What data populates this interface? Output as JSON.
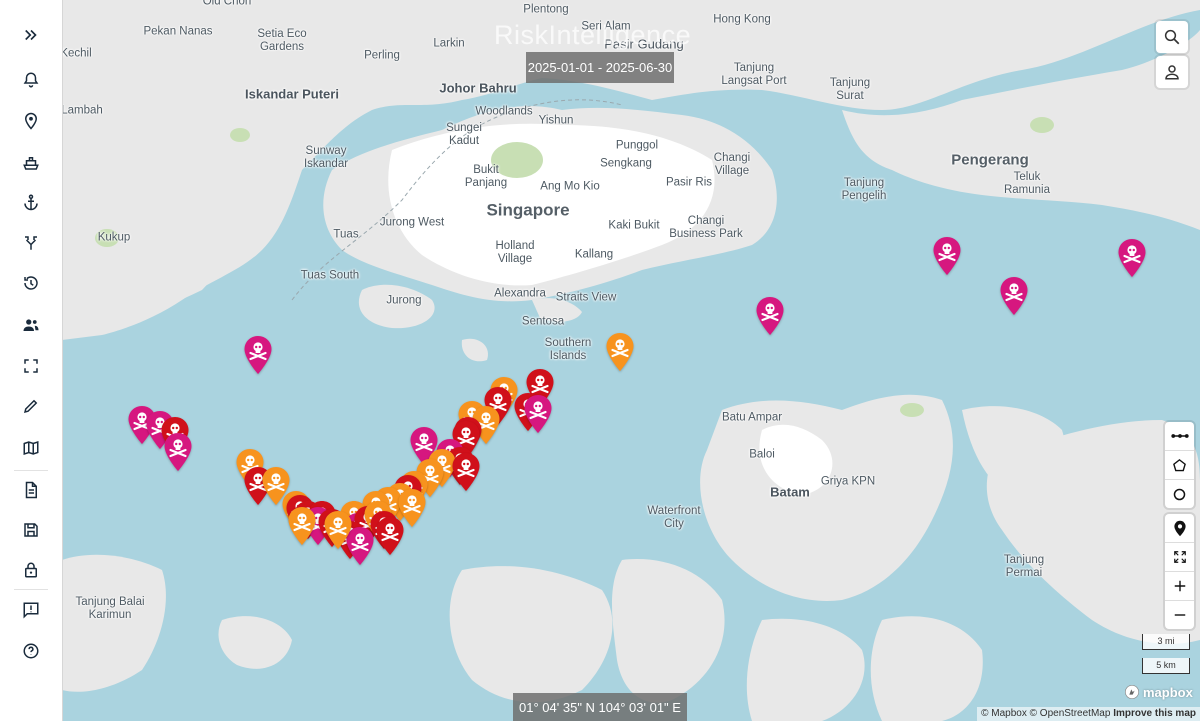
{
  "app": {
    "watermark": "RiskIntelligence"
  },
  "sidebar": {
    "items": [
      {
        "icon": "expand-chevrons-icon"
      },
      {
        "icon": "bell-icon"
      },
      {
        "icon": "location-pin-icon"
      },
      {
        "icon": "ship-icon"
      },
      {
        "icon": "anchor-icon"
      },
      {
        "icon": "route-fork-icon"
      },
      {
        "icon": "history-icon"
      },
      {
        "icon": "people-icon"
      },
      {
        "icon": "frame-select-icon"
      },
      {
        "icon": "pencil-icon"
      },
      {
        "icon": "map-icon"
      },
      {
        "icon": "document-icon"
      },
      {
        "icon": "save-icon"
      },
      {
        "icon": "lock-icon"
      },
      {
        "icon": "feedback-icon"
      },
      {
        "icon": "help-icon"
      }
    ]
  },
  "map": {
    "date_range": "2025-01-01 - 2025-06-30",
    "coordinate_readout": "01° 04' 35\" N 104° 03' 01\" E",
    "scale_miles": "3 mi",
    "scale_km": "5 km",
    "logo": "mapbox",
    "attribution": {
      "mapbox": "© Mapbox",
      "osm": "© OpenStreetMap",
      "improve": "Improve this map"
    },
    "colors": {
      "water": "#aad3df",
      "land": "#e8e8e8",
      "park": "#c8dfb4",
      "urban": "#ffffff",
      "marker_magenta": "#d6177f",
      "marker_orange": "#f7931e",
      "marker_red": "#d0101a"
    },
    "places": {
      "old_chon": "Old Chon",
      "pekan_nanas": "Pekan Nanas",
      "setia_eco_gardens": "Setia Eco\nGardens",
      "perling": "Perling",
      "larkin": "Larkin",
      "plentong": "Plentong",
      "seri_alam": "Seri Alam",
      "pasir_gudang": "Pasir Gudang",
      "hong_kong": "Hong Kong",
      "tanjung_langsat_port": "Tanjung\nLangsat Port",
      "tanjung_surat": "Tanjung\nSurat",
      "kechil": "Kechil",
      "iskandar_puteri": "Iskandar Puteri",
      "johor_bahru": "Johor Bahru",
      "woodlands": "Woodlands",
      "yishun": "Yishun",
      "lambah": "Lambah",
      "sungei_kadut": "Sungei\nKadut",
      "punggol": "Punggol",
      "sengkang": "Sengkang",
      "changi_village": "Changi\nVillage",
      "pengerang": "Pengerang",
      "teluk_ramunia": "Teluk\nRamunia",
      "sunway_iskandar": "Sunway\nIskandar",
      "bukit_panjang": "Bukit\nPanjang",
      "ang_mo_kio": "Ang Mo Kio",
      "pasir_ris": "Pasir Ris",
      "tanjung_pengelih": "Tanjung\nPengelih",
      "singapore": "Singapore",
      "jurong_west": "Jurong West",
      "kaki_bukit": "Kaki Bukit",
      "changi_business_park": "Changi\nBusiness Park",
      "kukup": "Kukup",
      "tuas": "Tuas",
      "holland_village": "Holland\nVillage",
      "kallang": "Kallang",
      "tuas_south": "Tuas South",
      "alexandra": "Alexandra",
      "straits_view": "Straits View",
      "jurong": "Jurong",
      "sentosa": "Sentosa",
      "southern_islands": "Southern\nIslands",
      "batu_ampar": "Batu Ampar",
      "baloi": "Baloi",
      "batam": "Batam",
      "griya_kpn": "Griya KPN",
      "waterfront_city": "Waterfront\nCity",
      "tanjung_permai": "Tanjung\nPermai",
      "tanjung_balai_karimun": "Tanjung Balai\nKarimun"
    }
  }
}
